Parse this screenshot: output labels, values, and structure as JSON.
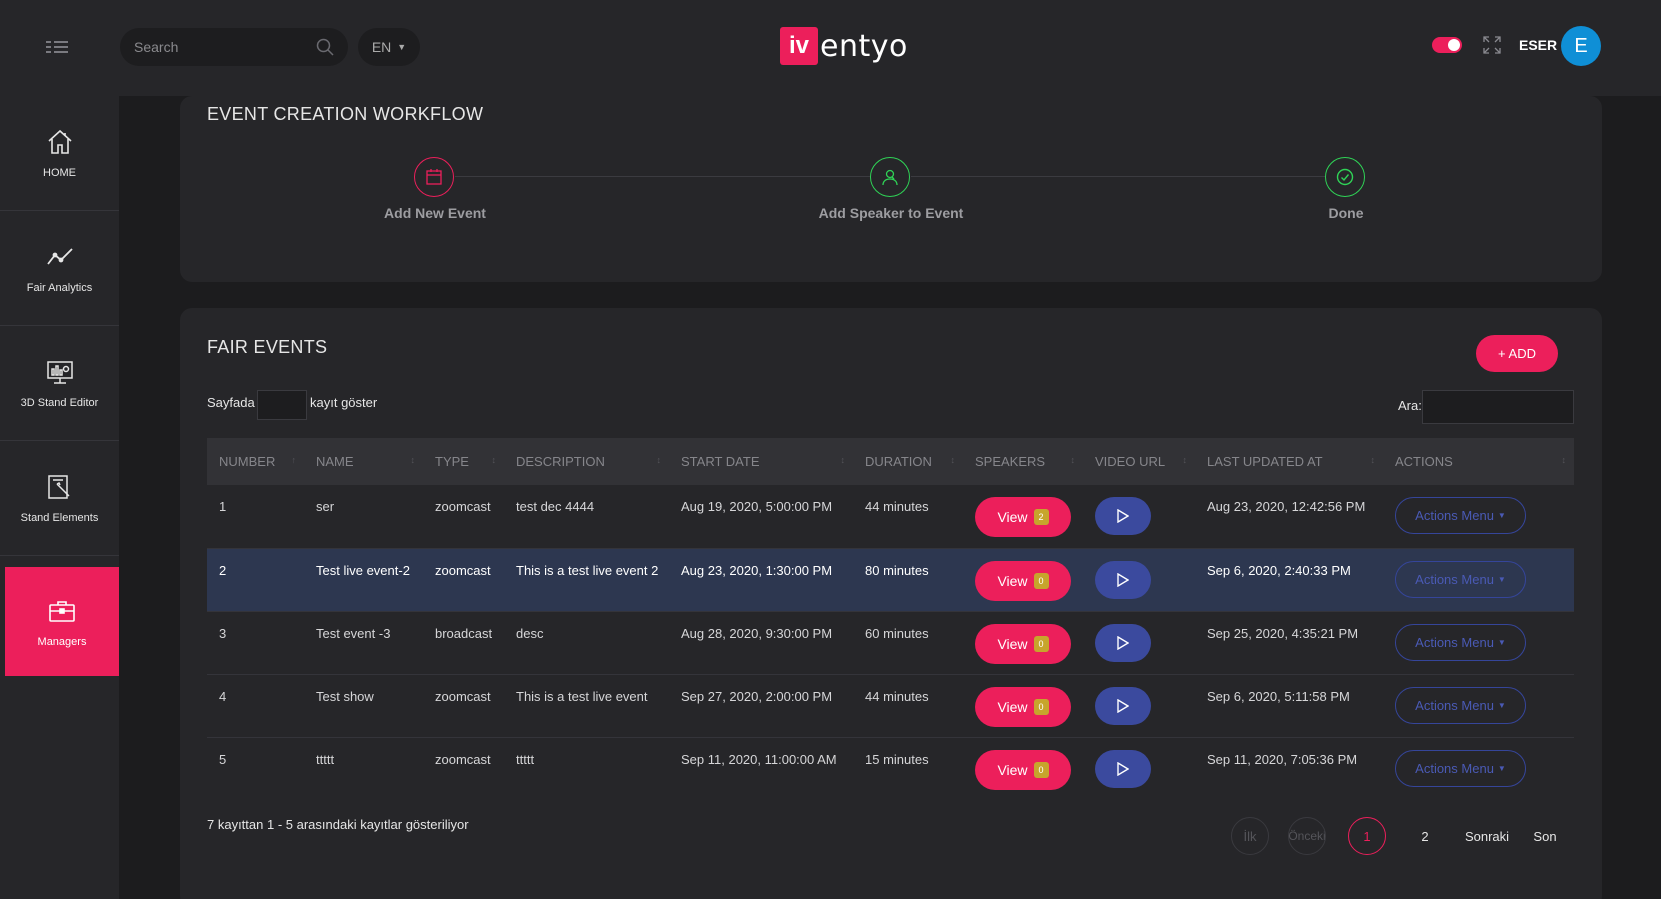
{
  "header": {
    "search_placeholder": "Search",
    "language": "EN",
    "logo_box": "iv",
    "logo_text": "entyo",
    "username": "ESER",
    "avatar_initial": "E"
  },
  "sidebar": {
    "items": [
      {
        "label": "HOME",
        "icon": "home-icon"
      },
      {
        "label": "Fair Analytics",
        "icon": "analytics-icon"
      },
      {
        "label": "3D Stand Editor",
        "icon": "monitor-icon"
      },
      {
        "label": "Stand Elements",
        "icon": "edit-icon"
      },
      {
        "label": "Managers",
        "icon": "briefcase-icon",
        "active": true
      }
    ]
  },
  "workflow": {
    "title": "EVENT CREATION WORKFLOW",
    "steps": [
      {
        "label": "Add New Event",
        "color": "#ec1f5b"
      },
      {
        "label": "Add Speaker to Event",
        "color": "#2fd356"
      },
      {
        "label": "Done",
        "color": "#2fd356"
      }
    ]
  },
  "events": {
    "title": "FAIR EVENTS",
    "add_label": "+ ADD",
    "length_prefix": "Sayfada",
    "length_suffix": "kayıt göster",
    "search_label": "Ara:",
    "columns": [
      "NUMBER",
      "NAME",
      "TYPE",
      "DESCRIPTION",
      "START DATE",
      "DURATION",
      "SPEAKERS",
      "VIDEO URL",
      "LAST UPDATED AT",
      "ACTIONS"
    ],
    "view_label": "View",
    "actions_label": "Actions Menu",
    "rows": [
      {
        "number": "1",
        "name": "ser",
        "type": "zoomcast",
        "description": "test dec 4444",
        "start": "Aug 19, 2020, 5:00:00 PM",
        "duration": "44 minutes",
        "speakers": "2",
        "updated": "Aug 23, 2020, 12:42:56 PM"
      },
      {
        "number": "2",
        "name": "Test live event-2",
        "type": "zoomcast",
        "description": "This is a test live event 2",
        "start": "Aug 23, 2020, 1:30:00 PM",
        "duration": "80 minutes",
        "speakers": "0",
        "updated": "Sep 6, 2020, 2:40:33 PM"
      },
      {
        "number": "3",
        "name": "Test event -3",
        "type": "broadcast",
        "description": "desc",
        "start": "Aug 28, 2020, 9:30:00 PM",
        "duration": "60 minutes",
        "speakers": "0",
        "updated": "Sep 25, 2020, 4:35:21 PM"
      },
      {
        "number": "4",
        "name": "Test show",
        "type": "zoomcast",
        "description": "This is a test live event",
        "start": "Sep 27, 2020, 2:00:00 PM",
        "duration": "44 minutes",
        "speakers": "0",
        "updated": "Sep 6, 2020, 5:11:58 PM"
      },
      {
        "number": "5",
        "name": "ttttt",
        "type": "zoomcast",
        "description": "ttttt",
        "start": "Sep 11, 2020, 11:00:00 AM",
        "duration": "15 minutes",
        "speakers": "0",
        "updated": "Sep 11, 2020, 7:05:36 PM"
      }
    ],
    "info": "7 kayıttan 1 - 5 arasındaki kayıtlar gösteriliyor",
    "pagination": {
      "first": "İlk",
      "prev": "Önceki",
      "pages": [
        "1",
        "2"
      ],
      "next": "Sonraki",
      "last": "Son"
    }
  },
  "colors": {
    "accent": "#ec1f5b",
    "success": "#2fd356",
    "primary": "#3b4a9e",
    "avatar": "#0f8fd6"
  }
}
